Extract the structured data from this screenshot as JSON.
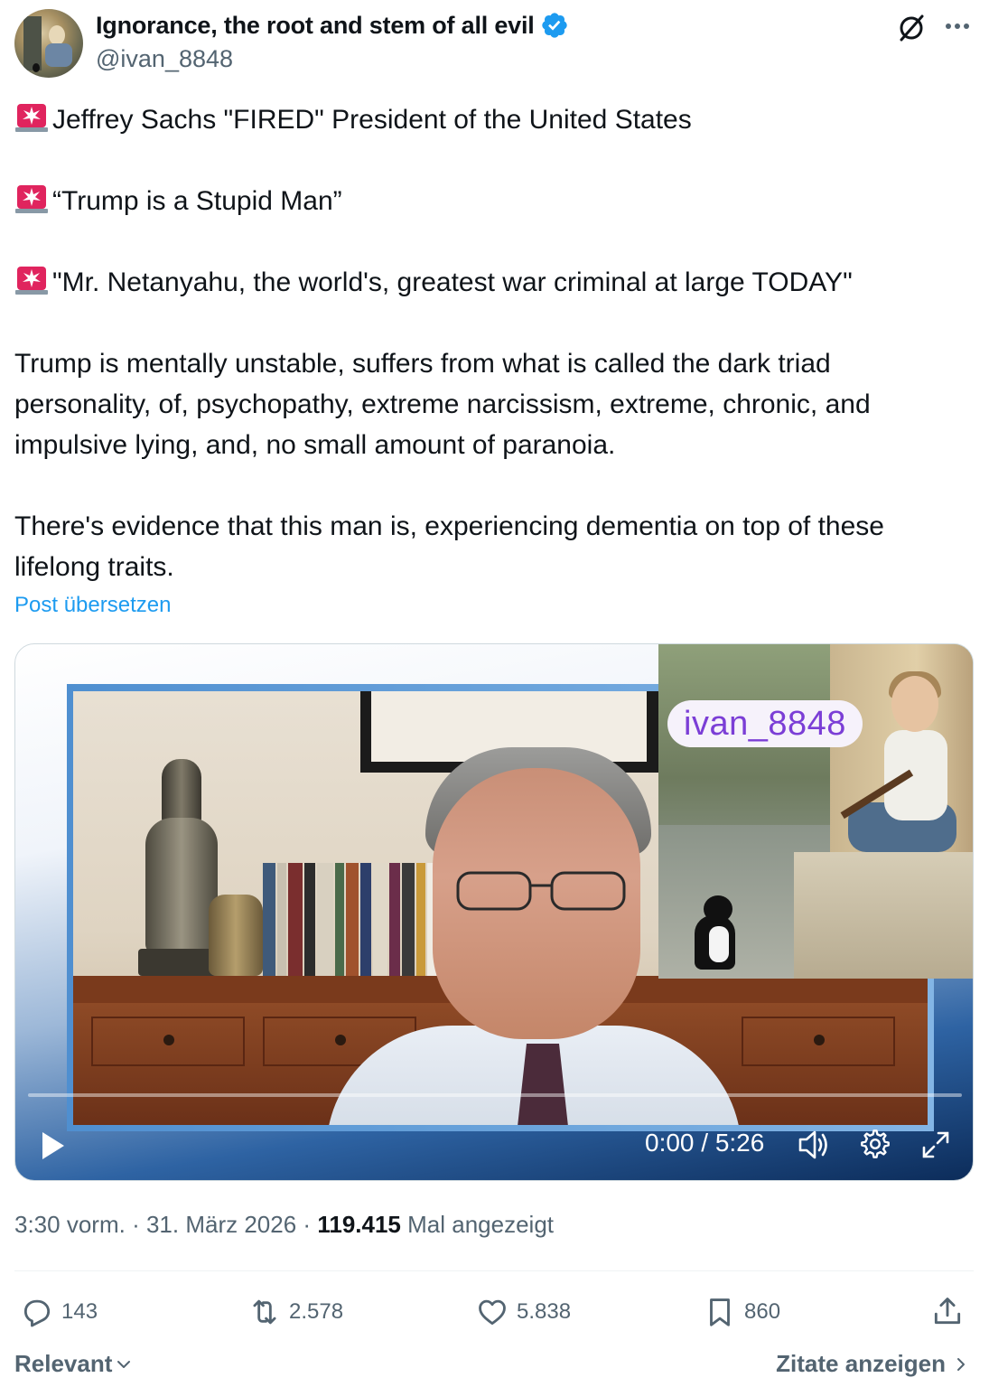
{
  "author": {
    "display_name": "Ignorance, the root and stem of all evil",
    "handle": "@ivan_8848",
    "verified": true,
    "verified_color": "#1d9bf0"
  },
  "tweet": {
    "lines": [
      "Jeffrey Sachs \"FIRED\" President of the United States",
      "“Trump is a Stupid Man”",
      "\"Mr. Netanyahu,  the world's, greatest war criminal at large TODAY\"",
      "Trump is mentally unstable, suffers from what is called the dark triad personality, of, psychopathy, extreme narcissism, extreme,  chronic, and impulsive lying, and, no small amount of paranoia.",
      "There's evidence that this man is, experiencing dementia on top of these lifelong traits."
    ],
    "bullet_icon": "siren-emoji",
    "translate_link": "Post übersetzen"
  },
  "video": {
    "watermark": "ivan_8848",
    "time": "0:00 / 5:26",
    "progress": 0.0,
    "controls": [
      "play-icon",
      "volume-icon",
      "settings-gear-icon",
      "fullscreen-icon"
    ]
  },
  "meta": {
    "time": "3:30 vorm.",
    "separator": "·",
    "date": "31. März 2026",
    "views_count": "119.415",
    "views_label": "Mal angezeigt"
  },
  "actions": {
    "replies": "143",
    "reposts": "2.578",
    "likes": "5.838",
    "bookmarks": "860"
  },
  "footer": {
    "sort_label": "Relevant",
    "quotes_label": "Zitate anzeigen"
  },
  "colors": {
    "text": "#0f1419",
    "secondary": "#536471",
    "link": "#1d9bf0",
    "watermark_text": "#7b3ed6"
  }
}
